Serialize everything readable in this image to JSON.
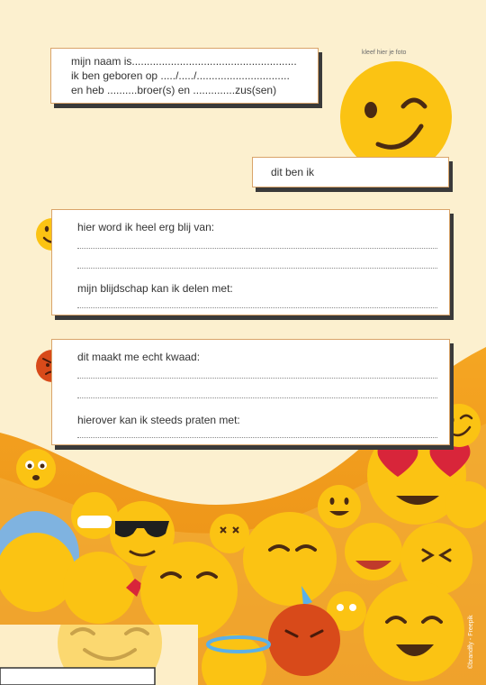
{
  "name_box": {
    "line1": "mijn naam is.......................................................",
    "line2": "ik ben geboren op ...../...../...............................",
    "line3": "en heb ..........broer(s) en ..............zus(sen)"
  },
  "photo_hint": "kleef hier je foto",
  "photo_caption": "dit ben ik",
  "happy": {
    "question1": "hier word ik heel erg blij van:",
    "question2": "mijn blijdschap kan ik delen met:"
  },
  "angry": {
    "question1": "dit maakt me echt kwaad:",
    "question2": "hierover kan ik steeds praten met:"
  },
  "credit": "©brandfly - Freepik",
  "colors": {
    "background": "#fcf0cf",
    "orange": "#f0a024",
    "emoji_yellow": "#fbc313",
    "angry_red": "#d84a1a",
    "box_shadow": "#3a3a3a"
  }
}
